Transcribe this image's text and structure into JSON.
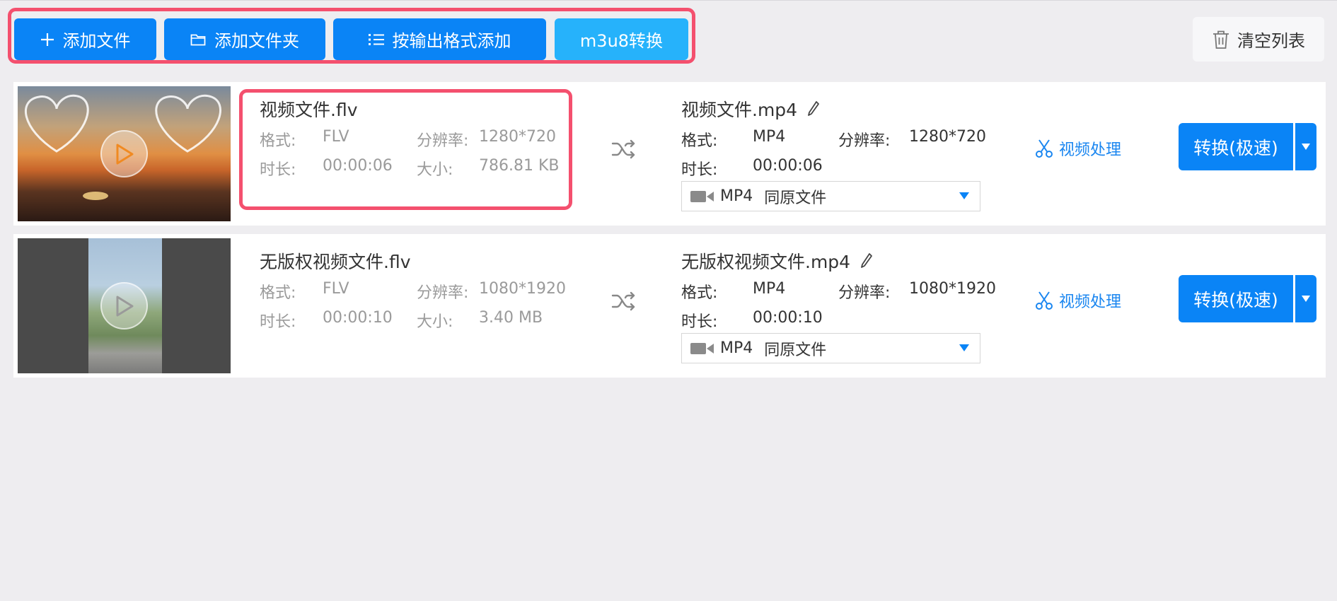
{
  "toolbar": {
    "add_file": "添加文件",
    "add_folder": "添加文件夹",
    "add_by_format": "按输出格式添加",
    "m3u8": "m3u8转换",
    "clear_list": "清空列表"
  },
  "labels": {
    "format": "格式:",
    "resolution": "分辨率:",
    "duration": "时长:",
    "size": "大小:",
    "video_process": "视频处理",
    "convert": "转换(极速)"
  },
  "files": [
    {
      "src_name": "视频文件.flv",
      "src_format": "FLV",
      "src_resolution": "1280*720",
      "src_duration": "00:00:06",
      "src_size": "786.81 KB",
      "dst_name": "视频文件.mp4",
      "dst_format": "MP4",
      "dst_resolution": "1280*720",
      "dst_duration": "00:00:06",
      "output_format": "MP4",
      "output_option": "同原文件"
    },
    {
      "src_name": "无版权视频文件.flv",
      "src_format": "FLV",
      "src_resolution": "1080*1920",
      "src_duration": "00:00:10",
      "src_size": "3.40 MB",
      "dst_name": "无版权视频文件.mp4",
      "dst_format": "MP4",
      "dst_resolution": "1080*1920",
      "dst_duration": "00:00:10",
      "output_format": "MP4",
      "output_option": "同原文件"
    }
  ],
  "colors": {
    "primary": "#0a84f6",
    "m3u8_button": "#26b2fb",
    "highlight_border": "#f4506e",
    "link": "#1a86f0"
  }
}
